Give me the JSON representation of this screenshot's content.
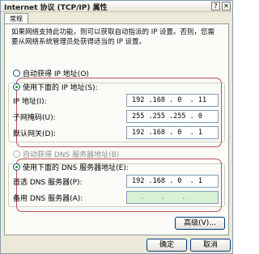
{
  "window": {
    "title": "Internet 协议 (TCP/IP) 属性",
    "help_button": "?",
    "close_button": "✕"
  },
  "tab": {
    "label": "常规"
  },
  "description": "如果网络支持此功能，则可以获取自动指派的 IP 设置。否则，您需要从网络系统管理员处获得适当的 IP 设置。",
  "ip_section": {
    "auto_option": "自动获得 IP 地址(O)",
    "manual_option": "使用下面的 IP 地址(S):",
    "fields": [
      {
        "label": "IP 地址(I):",
        "value": "192 .168 . 0  . 11"
      },
      {
        "label": "子网掩码(U):",
        "value": "255 .255 .255 . 0"
      },
      {
        "label": "默认网关(D):",
        "value": "192 .168 . 0  . 1"
      }
    ]
  },
  "dns_section": {
    "auto_option": "自动获得 DNS 服务器地址(B)",
    "manual_option": "使用下面的 DNS 服务器地址(E):",
    "fields": [
      {
        "label": "首选 DNS 服务器(P):",
        "value": "192 .168 . 0  . 1"
      },
      {
        "label": "备用 DNS 服务器(A):",
        "value": "  .    .    .  "
      }
    ]
  },
  "buttons": {
    "advanced": "高级(V)...",
    "ok": "确定",
    "cancel": "取消"
  },
  "colors": {
    "highlight_border": "#c0505a",
    "dialog_background": "#ece9d8",
    "empty_field_fill": "#d8f0d4"
  }
}
